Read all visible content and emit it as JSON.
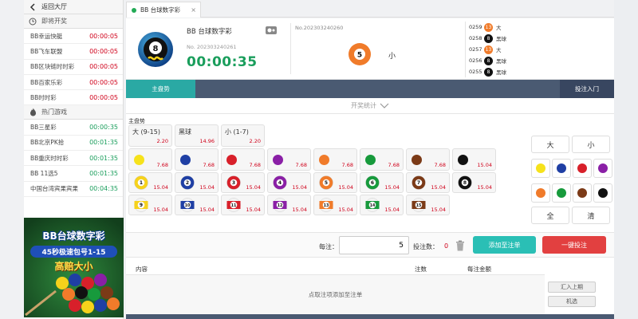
{
  "sidebar": {
    "back_label": "返回大厅",
    "section_now": "即将开奖",
    "now_items": [
      {
        "name": "BB幸运快艇",
        "time": "00:00:05",
        "color": "red"
      },
      {
        "name": "BB飞车联盟",
        "time": "00:00:05",
        "color": "red"
      },
      {
        "name": "BB区块链时时彩",
        "time": "00:00:05",
        "color": "red"
      },
      {
        "name": "BB百家乐彩",
        "time": "00:00:05",
        "color": "red"
      },
      {
        "name": "BB时时彩",
        "time": "00:00:05",
        "color": "red"
      }
    ],
    "section_hot": "热门游戏",
    "hot_items": [
      {
        "name": "BB三星彩",
        "time": "00:00:35",
        "color": "green"
      },
      {
        "name": "BB北京PK拾",
        "time": "00:01:35",
        "color": "green"
      },
      {
        "name": "BB重庆时时彩",
        "time": "00:01:35",
        "color": "green"
      },
      {
        "name": "BB 11选5",
        "time": "00:01:35",
        "color": "green"
      },
      {
        "name": "中国台湾宾果宾果",
        "time": "00:04:35",
        "color": "green"
      }
    ],
    "promo": {
      "line1": "BB台球数字彩",
      "line2": "45秒极速包号1-15",
      "line3": "高赔大小"
    }
  },
  "tab": {
    "label": "BB 台球数字彩",
    "close": "×"
  },
  "header": {
    "game_name": "BB 台球数字彩",
    "current_issue": "No. 202303240261",
    "countdown": "00:00:35",
    "last_issue": "No.202303240260",
    "last_ball": "5",
    "last_result": "小",
    "history": [
      {
        "no": "0259",
        "ball": "13",
        "label": "大",
        "color": "#f07b2a"
      },
      {
        "no": "0258",
        "ball": "8",
        "label": "黑球",
        "color": "#111111"
      },
      {
        "no": "0257",
        "ball": "13",
        "label": "大",
        "color": "#f07b2a"
      },
      {
        "no": "0256",
        "ball": "8",
        "label": "黑球",
        "color": "#111111"
      },
      {
        "no": "0255",
        "ball": "8",
        "label": "黑球",
        "color": "#111111"
      }
    ]
  },
  "nav": {
    "main_tab": "主盘势",
    "bet_entry": "投注入门"
  },
  "stats_toggle": "开奖统计",
  "board": {
    "section_title": "主盘势",
    "size_cells": [
      {
        "label": "大 (9-15)",
        "odds": "2.20"
      },
      {
        "label": "黑球",
        "odds": "14.96"
      },
      {
        "label": "小 (1-7)",
        "odds": "2.20"
      }
    ],
    "color_cells": [
      {
        "color": "#f6e21b",
        "odds": "7.68"
      },
      {
        "color": "#1f3fa4",
        "odds": "7.68"
      },
      {
        "color": "#d8202a",
        "odds": "7.68"
      },
      {
        "color": "#8a1fa6",
        "odds": "7.68"
      },
      {
        "color": "#f07b2a",
        "odds": "7.68"
      },
      {
        "color": "#179a3c",
        "odds": "7.68"
      },
      {
        "color": "#7b3a17",
        "odds": "7.68"
      },
      {
        "color": "#111111",
        "odds": "15.04"
      }
    ],
    "number_cells": [
      {
        "num": "1",
        "color": "#f6d21b",
        "stripe": false,
        "odds": "15.04"
      },
      {
        "num": "2",
        "color": "#1f3fa4",
        "stripe": false,
        "odds": "15.04"
      },
      {
        "num": "3",
        "color": "#d8202a",
        "stripe": false,
        "odds": "15.04"
      },
      {
        "num": "4",
        "color": "#8a1fa6",
        "stripe": false,
        "odds": "15.04"
      },
      {
        "num": "5",
        "color": "#f07b2a",
        "stripe": false,
        "odds": "15.04"
      },
      {
        "num": "6",
        "color": "#179a3c",
        "stripe": false,
        "odds": "15.04"
      },
      {
        "num": "7",
        "color": "#7b3a17",
        "stripe": false,
        "odds": "15.04"
      },
      {
        "num": "8",
        "color": "#111111",
        "stripe": false,
        "odds": "15.04"
      },
      {
        "num": "9",
        "color": "#f6d21b",
        "stripe": true,
        "odds": "15.04"
      },
      {
        "num": "10",
        "color": "#1f3fa4",
        "stripe": true,
        "odds": "15.04"
      },
      {
        "num": "11",
        "color": "#d8202a",
        "stripe": true,
        "odds": "15.04"
      },
      {
        "num": "12",
        "color": "#8a1fa6",
        "stripe": true,
        "odds": "15.04"
      },
      {
        "num": "13",
        "color": "#f07b2a",
        "stripe": true,
        "odds": "15.04"
      },
      {
        "num": "14",
        "color": "#179a3c",
        "stripe": true,
        "odds": "15.04"
      },
      {
        "num": "15",
        "color": "#7b3a17",
        "stripe": true,
        "odds": "15.04"
      }
    ]
  },
  "quick": {
    "big": "大",
    "small": "小",
    "all": "全",
    "clear": "清",
    "colors": [
      "#f6e21b",
      "#1f3fa4",
      "#d8202a",
      "#8a1fa6",
      "#f07b2a",
      "#179a3c",
      "#7b3a17",
      "#111111"
    ]
  },
  "betbar": {
    "amount_label": "每注：",
    "amount_value": "5",
    "count_label": "投注数：",
    "count_value": "0",
    "add_label": "添加至注单",
    "bet_label": "一键投注"
  },
  "table": {
    "col_content": "内容",
    "col_count": "注数",
    "col_amount": "每注金额",
    "empty_text": "点取注项添加至注单",
    "btn_import": "汇入上期",
    "btn_random": "机选"
  }
}
